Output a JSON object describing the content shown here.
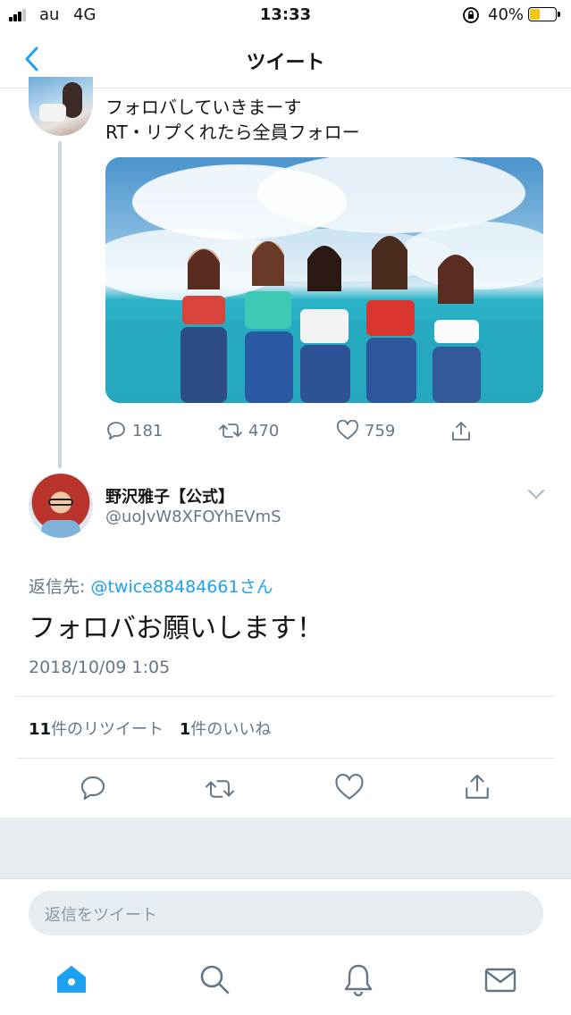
{
  "status": {
    "carrier": "au",
    "network": "4G",
    "time": "13:33",
    "battery": "40%",
    "battery_level": 0.4
  },
  "nav": {
    "title": "ツイート",
    "back_icon": "chevron-left-icon"
  },
  "parent_tweet": {
    "line1": "フォロバしていきまーす",
    "line2": "RT・リプくれたら全員フォロー",
    "replies": "181",
    "retweets": "470",
    "likes": "759"
  },
  "main_tweet": {
    "display_name": "野沢雅子【公式】",
    "handle": "@uoJvW8XFOYhEVmS",
    "reply_prefix": "返信先: ",
    "reply_to": "@twice88484661さん",
    "text": "フォロバお願いします！",
    "timestamp": "2018/10/09 1:05",
    "retweet_count": "11",
    "retweet_label": "件のリツイート",
    "like_count": "1",
    "like_label": "件のいいね"
  },
  "reply_box": {
    "placeholder": "返信をツイート"
  },
  "tabs": [
    "home-icon",
    "search-icon",
    "bell-icon",
    "mail-icon"
  ],
  "colors": {
    "accent": "#1da1f2",
    "muted": "#657786",
    "divider": "#e1e8ed",
    "battery": "#f5c518"
  }
}
